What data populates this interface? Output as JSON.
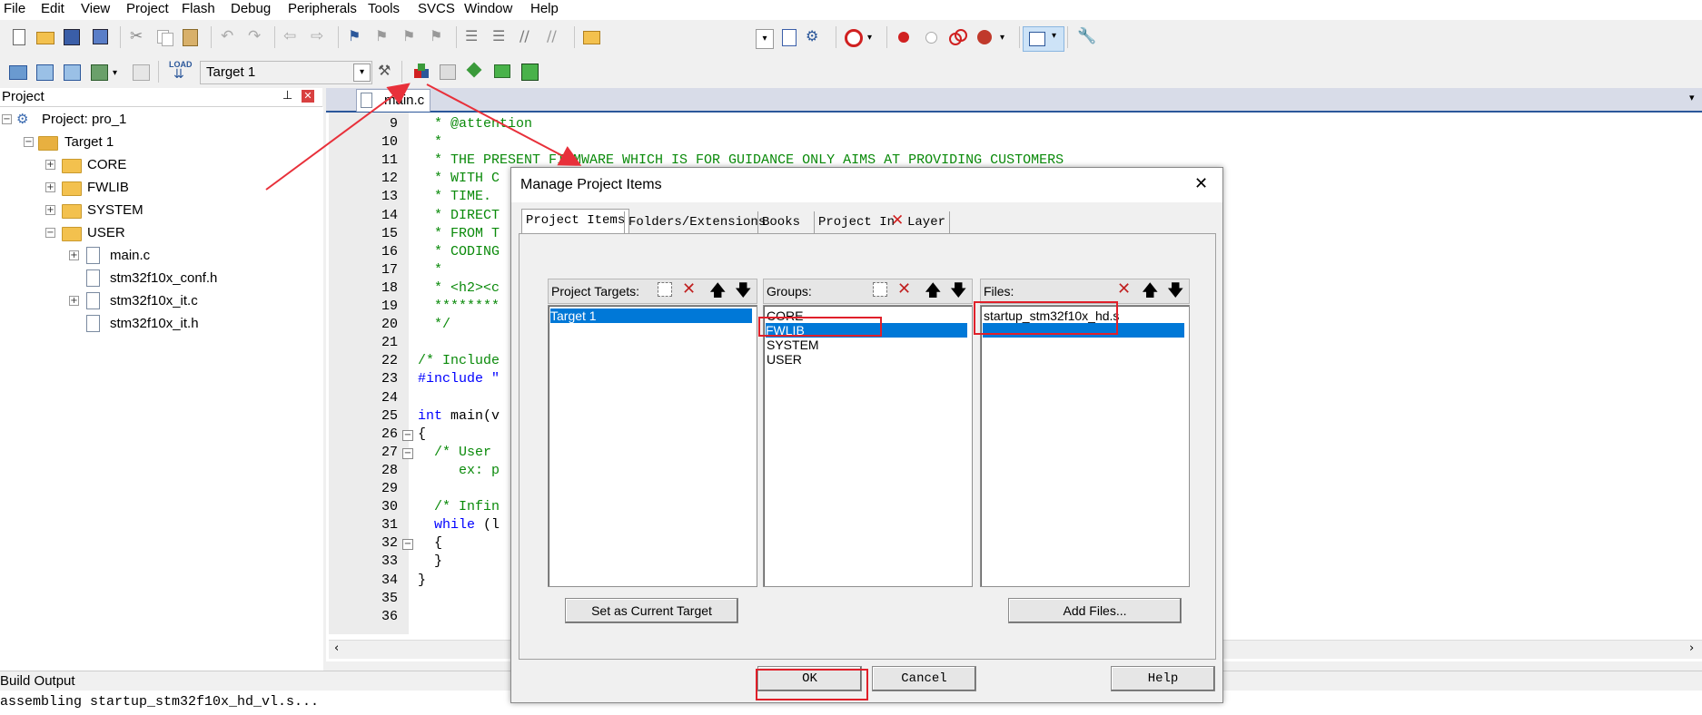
{
  "menu": [
    "File",
    "Edit",
    "View",
    "Project",
    "Flash",
    "Debug",
    "Peripherals",
    "Tools",
    "SVCS",
    "Window",
    "Help"
  ],
  "toolbar2": {
    "target_select": "Target 1"
  },
  "project_pane": {
    "title": "Project",
    "root": "Project: pro_1",
    "target": "Target 1",
    "groups": [
      "CORE",
      "FWLIB",
      "SYSTEM",
      "USER"
    ],
    "files": [
      "main.c",
      "stm32f10x_conf.h",
      "stm32f10x_it.c",
      "stm32f10x_it.h"
    ]
  },
  "editor": {
    "tab": "main.c",
    "line_numbers": [
      "9",
      "10",
      "11",
      "12",
      "13",
      "14",
      "15",
      "16",
      "17",
      "18",
      "19",
      "20",
      "21",
      "22",
      "23",
      "24",
      "25",
      "26",
      "27",
      "28",
      "29",
      "30",
      "31",
      "32",
      "33",
      "34",
      "35",
      "36"
    ],
    "lines": [
      "  * @attention",
      "  *",
      "  * THE PRESENT FIRMWARE WHICH IS FOR GUIDANCE ONLY AIMS AT PROVIDING CUSTOMERS",
      "  * WITH C",
      "  * TIME. ",
      "  * DIRECT",
      "  * FROM T",
      "  * CODING",
      "  *",
      "  * <h2><c",
      "  ********",
      "  */",
      "",
      "/* Include",
      "#include \"",
      "",
      "int main(v",
      "{",
      "  /* User ",
      "     ex: p",
      "",
      "  /* Infin",
      "  while (l",
      "  {",
      "  }",
      "}",
      "",
      ""
    ]
  },
  "build_output": {
    "title": "Build Output",
    "text": "assembling startup_stm32f10x_hd_vl.s..."
  },
  "dialog": {
    "title": "Manage Project Items",
    "close": "✕",
    "tabs": [
      "Project Items",
      "Folders/Extensions",
      "Books",
      "Project In",
      "Layer"
    ],
    "targets": {
      "label": "Project Targets:",
      "items": [
        "Target 1"
      ]
    },
    "groups": {
      "label": "Groups:",
      "items": [
        "CORE",
        "FWLIB",
        "SYSTEM",
        "USER"
      ]
    },
    "files": {
      "label": "Files:",
      "items": [
        "startup_stm32f10x_hd.s"
      ]
    },
    "set_current_target": "Set as Current Target",
    "add_files": "Add Files...",
    "ok": "OK",
    "cancel": "Cancel",
    "help": "Help"
  },
  "colors": {
    "annotation": "#e0202a",
    "selection": "#0078d7",
    "comment": "#0a8a0a",
    "keyword": "#0000ff"
  }
}
